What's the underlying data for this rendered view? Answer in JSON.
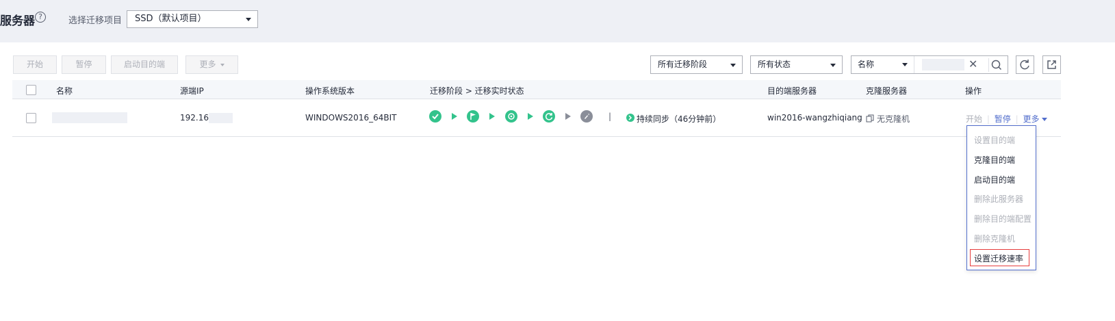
{
  "header": {
    "title": "服务器",
    "project_label": "选择迁移项目",
    "project_value": "SSD（默认项目）"
  },
  "toolbar": {
    "start": "开始",
    "pause": "暂停",
    "launch_target": "启动目的端",
    "more": "更多",
    "stage_filter": "所有迁移阶段",
    "status_filter": "所有状态",
    "search_field": "名称"
  },
  "table": {
    "columns": [
      "名称",
      "源端IP",
      "操作系统版本",
      "迁移阶段 > 迁移实时状态",
      "目的端服务器",
      "克隆服务器",
      "操作"
    ],
    "rows": [
      {
        "ip": "192.168",
        "os": "WINDOWS2016_64BIT",
        "status": "持续同步（46分钟前）",
        "target": "win2016-wangzhiqiang",
        "clone": "无克隆机",
        "actions": {
          "start": "开始",
          "pause": "暂停",
          "more": "更多"
        }
      }
    ]
  },
  "menu": {
    "items": [
      {
        "label": "设置目的端",
        "enabled": false
      },
      {
        "label": "克隆目的端",
        "enabled": true
      },
      {
        "label": "启动目的端",
        "enabled": true
      },
      {
        "label": "删除此服务器",
        "enabled": false
      },
      {
        "label": "删除目的端配置",
        "enabled": false
      },
      {
        "label": "删除克隆机",
        "enabled": false
      },
      {
        "label": "设置迁移速率",
        "enabled": true
      }
    ]
  },
  "colors": {
    "accent": "#526ecc",
    "success": "#33c38c",
    "highlight": "#e63c3c",
    "stage_pending": "#8a8e99"
  },
  "icons": [
    "help-icon",
    "check-icon",
    "flag-icon",
    "sync-icon",
    "refresh-icon",
    "rocket-icon",
    "clear-icon",
    "search-icon",
    "export-icon",
    "copy-icon"
  ]
}
